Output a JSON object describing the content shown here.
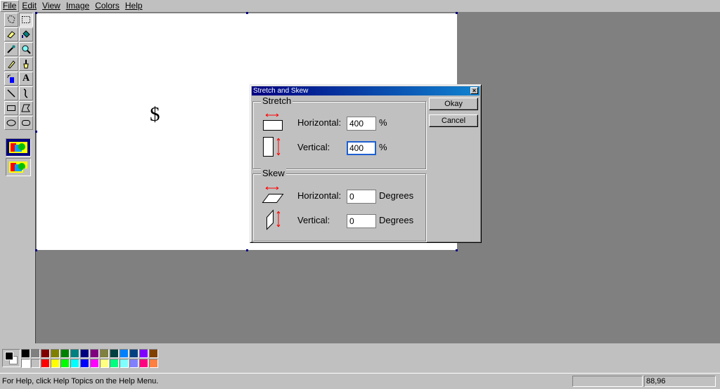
{
  "menubar": {
    "items": [
      {
        "label": "File"
      },
      {
        "label": "Edit"
      },
      {
        "label": "View"
      },
      {
        "label": "Image"
      },
      {
        "label": "Colors"
      },
      {
        "label": "Help"
      }
    ]
  },
  "toolbox": {
    "tools": [
      {
        "name": "free-select-icon"
      },
      {
        "name": "rect-select-icon"
      },
      {
        "name": "eraser-icon"
      },
      {
        "name": "fill-icon"
      },
      {
        "name": "color-picker-icon"
      },
      {
        "name": "magnifier-icon"
      },
      {
        "name": "pencil-icon"
      },
      {
        "name": "brush-icon"
      },
      {
        "name": "airbrush-icon"
      },
      {
        "name": "text-icon",
        "glyph": "A"
      },
      {
        "name": "line-icon"
      },
      {
        "name": "curve-icon"
      },
      {
        "name": "rectangle-icon"
      },
      {
        "name": "polygon-icon"
      },
      {
        "name": "ellipse-icon"
      },
      {
        "name": "rounded-rect-icon"
      }
    ]
  },
  "canvas": {
    "text": "$"
  },
  "dialog": {
    "title": "Stretch and Skew",
    "close": "×",
    "stretch": {
      "legend": "Stretch",
      "horizontal_label": "Horizontal:",
      "horizontal_value": "400",
      "horizontal_unit": "%",
      "vertical_label": "Vertical:",
      "vertical_value": "400",
      "vertical_unit": "%"
    },
    "skew": {
      "legend": "Skew",
      "horizontal_label": "Horizontal:",
      "horizontal_value": "0",
      "horizontal_unit": "Degrees",
      "vertical_label": "Vertical:",
      "vertical_value": "0",
      "vertical_unit": "Degrees"
    },
    "okay_label": "Okay",
    "cancel_label": "Cancel"
  },
  "palette": {
    "foreground": "#000000",
    "background": "#ffffff",
    "colors_top": [
      "#000000",
      "#808080",
      "#800000",
      "#808000",
      "#008000",
      "#008080",
      "#000080",
      "#800080",
      "#808040",
      "#004040",
      "#0080ff",
      "#004080",
      "#8000ff",
      "#804000"
    ],
    "colors_bottom": [
      "#ffffff",
      "#c0c0c0",
      "#ff0000",
      "#ffff00",
      "#00ff00",
      "#00ffff",
      "#0000ff",
      "#ff00ff",
      "#ffff80",
      "#00ff80",
      "#80ffff",
      "#8080ff",
      "#ff0080",
      "#ff8040"
    ]
  },
  "statusbar": {
    "help_text": "For Help, click Help Topics on the Help Menu.",
    "coords": "88,96"
  }
}
